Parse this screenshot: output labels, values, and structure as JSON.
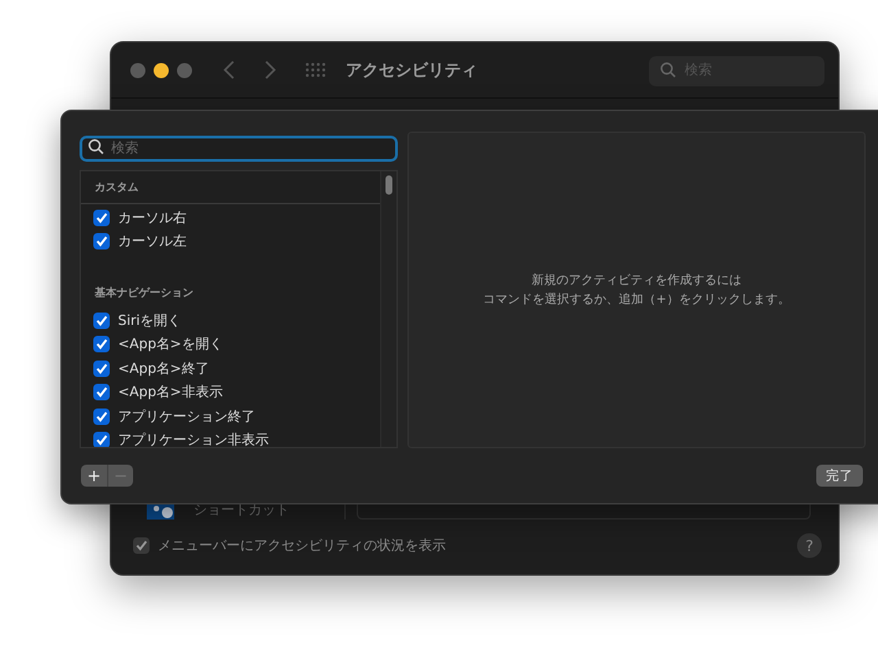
{
  "window": {
    "title": "アクセシビリティ",
    "search": {
      "placeholder": "検索"
    },
    "shortcut_popup": {
      "label": "ショートカット"
    },
    "status_option": {
      "label": "メニューバーにアクセシビリティの状況を表示",
      "checked": true
    },
    "help": "?"
  },
  "sheet": {
    "search": {
      "placeholder": "検索"
    },
    "sections": [
      {
        "header": "カスタム",
        "items": [
          {
            "label": "カーソル右",
            "checked": true
          },
          {
            "label": "カーソル左",
            "checked": true
          }
        ]
      },
      {
        "header": "基本ナビゲーション",
        "items": [
          {
            "label": "Siriを開く",
            "checked": true
          },
          {
            "label": "<App名>を開く",
            "checked": true
          },
          {
            "label": "<App名>終了",
            "checked": true
          },
          {
            "label": "<App名>非表示",
            "checked": true
          },
          {
            "label": "アプリケーション終了",
            "checked": true
          },
          {
            "label": "アプリケーション非表示",
            "checked": true
          }
        ]
      }
    ],
    "message": [
      "新規のアクティビティを作成するには",
      "コマンドを選択するか、追加（+）をクリックします。"
    ],
    "add": {
      "label": "+",
      "disabled": false
    },
    "remove": {
      "label": "−",
      "disabled": true
    },
    "done": "完了"
  }
}
